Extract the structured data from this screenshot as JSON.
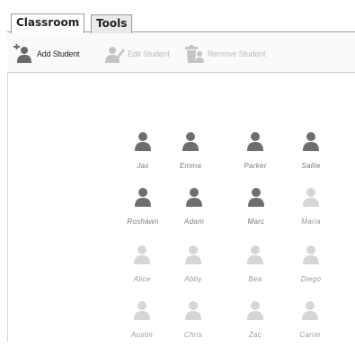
{
  "tabs": [
    {
      "label": "Classroom",
      "active": true
    },
    {
      "label": "Tools",
      "active": false
    }
  ],
  "toolbar": {
    "add_student": {
      "label": "Add Student",
      "icon": "add-student-icon",
      "enabled": true
    },
    "edit_student": {
      "label": "Edit Student",
      "icon": "edit-student-icon",
      "enabled": false
    },
    "remove_student": {
      "label": "Remove Student",
      "icon": "remove-student-icon",
      "enabled": false
    }
  },
  "colors": {
    "present_icon": "#6e6e6e",
    "absent_icon": "#d6d6d6"
  },
  "students": [
    {
      "name": "Jax",
      "status": "present"
    },
    {
      "name": "Emma",
      "status": "present"
    },
    {
      "name": "Parker",
      "status": "present"
    },
    {
      "name": "Sallie",
      "status": "present"
    },
    {
      "name": "Roshawn",
      "status": "present"
    },
    {
      "name": "Adam",
      "status": "present"
    },
    {
      "name": "Marc",
      "status": "present"
    },
    {
      "name": "Maria",
      "status": "absent"
    },
    {
      "name": "Alice",
      "status": "absent"
    },
    {
      "name": "Abby",
      "status": "absent"
    },
    {
      "name": "Bea",
      "status": "absent"
    },
    {
      "name": "Diego",
      "status": "absent"
    },
    {
      "name": "Austin",
      "status": "absent"
    },
    {
      "name": "Chris",
      "status": "absent"
    },
    {
      "name": "Zac",
      "status": "absent"
    },
    {
      "name": "Carrie",
      "status": "absent"
    }
  ]
}
